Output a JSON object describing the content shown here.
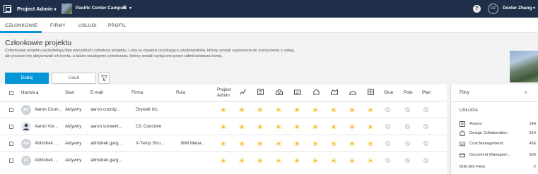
{
  "topbar": {
    "app_title": "Project Admin",
    "app_caret": "▾",
    "project_name": "Pacific Center Campus",
    "project_badge": "B",
    "project_caret": "▾",
    "help": "?",
    "user_initials": "DZ",
    "user_name": "Dexter Zhang",
    "user_caret": "▾"
  },
  "tabs": [
    {
      "label": "CZŁONKOWIE",
      "active": true
    },
    {
      "label": "FIRMY",
      "active": false
    },
    {
      "label": "USŁUGI",
      "active": false
    },
    {
      "label": "PROFIL",
      "active": false
    }
  ],
  "page": {
    "title": "Członkowie projektu",
    "description": "Członkowie projektu wyświetlają listę wszystkich członków projektu. Lista ta zawiera oczekujące użytkowników, którzy zostali zaproszeni do korzystania z usług, ale jeszcze nie aktywowali ich konta, a także nieaktywni członkowie, którzy zostali wyłączeni przez administratora konta.",
    "add_label": "Dodaj",
    "remove_label": "Usuń"
  },
  "table": {
    "headers": {
      "name": "Nazwa",
      "sort": "▴",
      "status": "Stan",
      "email": "E-mail",
      "company": "Firma",
      "role": "Rola",
      "project_admin": "Project Admin",
      "glue": "Glue",
      "field": "Pole",
      "plan": "Plan"
    },
    "service_icons": [
      "insight-icon",
      "docs-icon",
      "build-icon",
      "cost-icon",
      "collaboration-icon",
      "model-icon",
      "field-icon",
      "bim-icon"
    ],
    "rows": [
      {
        "initials": "AC",
        "avatar_color": "#cfd4db",
        "name": "Aaron Coun...",
        "status": "Aktywny",
        "email": "aaron.courdy...",
        "company": "Drywall Inc.",
        "role": ""
      },
      {
        "initials": "",
        "avatar_color": "#dfe3ea",
        "name": "Aaron Vor...",
        "status": "Aktywny",
        "email": "aaron.vorwerk...",
        "company": "CC Concrete",
        "role": ""
      },
      {
        "initials": "AG",
        "avatar_color": "#cfd4db",
        "name": "Abhishek ...",
        "status": "Aktywny",
        "email": "abhishek.garg...",
        "company": "X-Temp Stru...",
        "role": "BIM Mana..."
      },
      {
        "initials": "AT",
        "avatar_color": "#cfd4db",
        "name": "Abhishek ...",
        "status": "Aktywny",
        "email": "abhishek.garg...",
        "company": "",
        "role": ""
      }
    ]
  },
  "filter_panel": {
    "title": "Filtry",
    "close": "×",
    "section": "USŁUGA",
    "items": [
      {
        "label": "Assets",
        "count": "148",
        "icon": "assets-icon"
      },
      {
        "label": "Design Collaboration",
        "count": "514",
        "icon": "design-collaboration-icon"
      },
      {
        "label": "Cost Management",
        "count": "456",
        "icon": "cost-management-icon"
      },
      {
        "label": "Document Managem...",
        "count": "566",
        "icon": "document-management-icon"
      },
      {
        "label": "BIM 360 Field",
        "count": "2",
        "icon": ""
      }
    ]
  },
  "colors": {
    "topbar": "#1f2f4a",
    "accent": "#0696d7",
    "sun": "#f6b50f",
    "disabled": "#c6c6c6"
  }
}
